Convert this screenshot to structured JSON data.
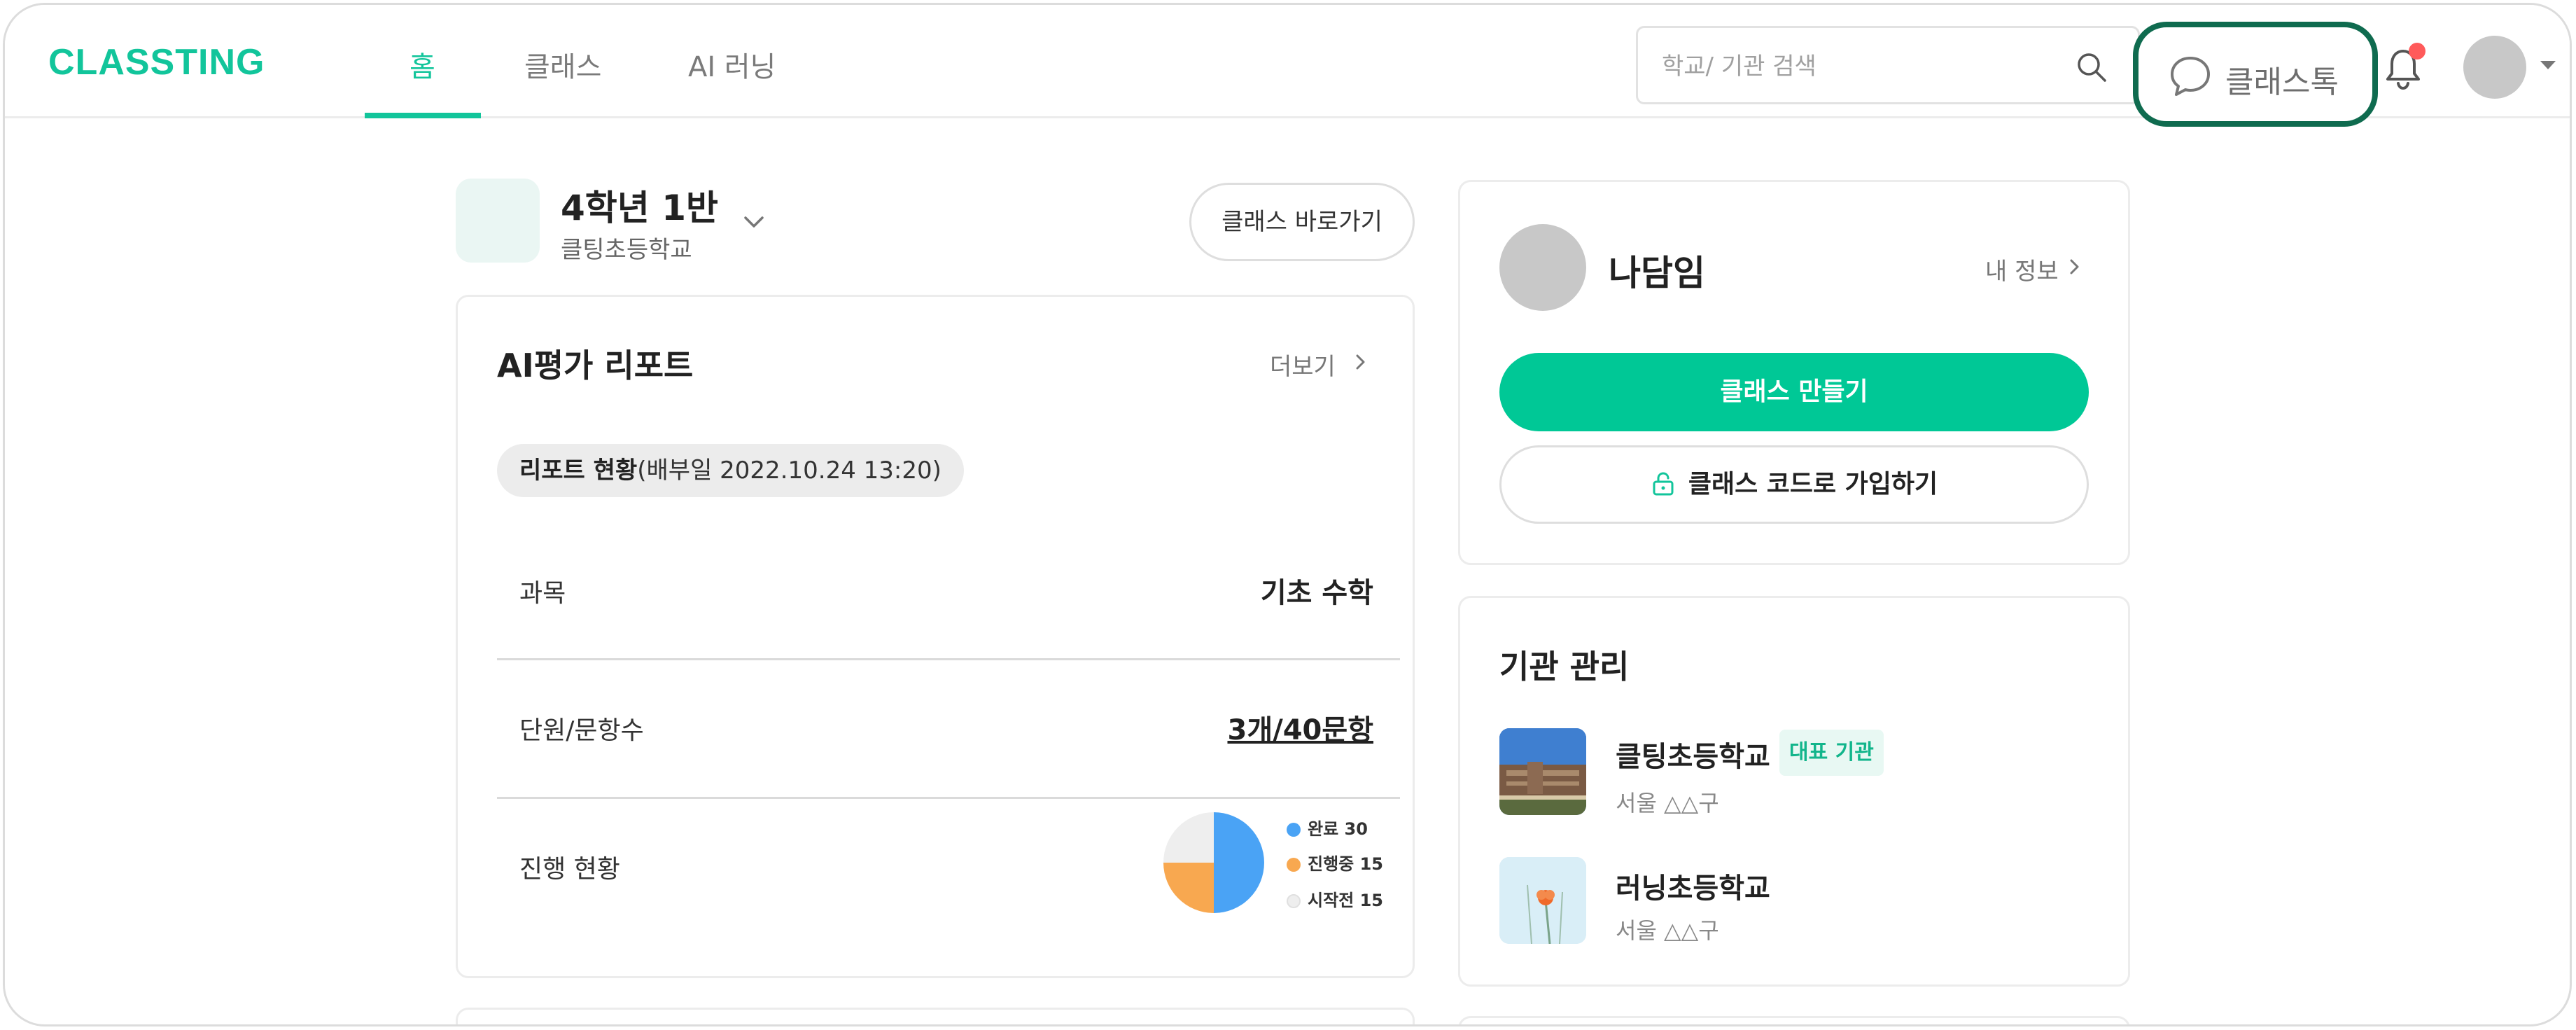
{
  "header": {
    "logo": "CLASSTING",
    "tabs": [
      {
        "label": "홈",
        "active": true
      },
      {
        "label": "클래스",
        "active": false
      },
      {
        "label": "AI 러닝",
        "active": false
      }
    ],
    "search_placeholder": "학교/ 기관 검색",
    "classtalk_label": "클래스톡",
    "has_notification": true
  },
  "class_header": {
    "name": "4학년 1반",
    "school": "클팅초등학교",
    "go_button": "클래스 바로가기"
  },
  "report": {
    "title": "AI평가 리포트",
    "more": "더보기",
    "status_bold": "리포트 현황",
    "status_rest": "(배부일 2022.10.24 13:20)",
    "rows": [
      {
        "label": "과목",
        "value": "기초 수학"
      },
      {
        "label": "단원/문항수",
        "value": "3개/40문항"
      },
      {
        "label": "진행 현황"
      }
    ]
  },
  "chart_data": {
    "type": "pie",
    "series": [
      {
        "name": "완료",
        "value": 30,
        "color": "#4aa3f5"
      },
      {
        "name": "진행중",
        "value": 15,
        "color": "#f8a850"
      },
      {
        "name": "시작전",
        "value": 15,
        "color": "#eeeeee"
      }
    ],
    "legend_labels": [
      "완료 30",
      "진행중 15",
      "시작전 15"
    ]
  },
  "profile": {
    "name": "나담임",
    "my_info": "내 정보",
    "make_class": "클래스 만들기",
    "join_by_code": "클래스 코드로 가입하기"
  },
  "organizations": {
    "title": "기관 관리",
    "items": [
      {
        "name": "클팅초등학교",
        "badge": "대표 기관",
        "location": "서울 △△구"
      },
      {
        "name": "러닝초등학교",
        "location": "서울 △△구"
      }
    ]
  },
  "colors": {
    "brand": "#12c59b",
    "primary_button": "#00c896",
    "highlight_ring": "#0f6b4f",
    "notification_dot": "#ff5a5a"
  }
}
